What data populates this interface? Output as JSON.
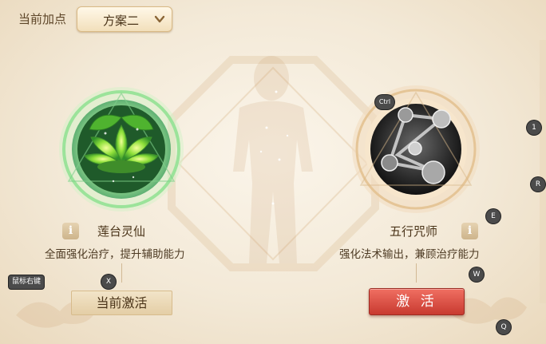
{
  "top": {
    "plan_label": "当前加点",
    "plan_value": "方案二"
  },
  "classes": [
    {
      "name": "莲台灵仙",
      "desc": "全面强化治疗，提升辅助能力",
      "info": "i",
      "icon": "lotus-icon"
    },
    {
      "name": "五行咒师",
      "desc": "强化法术输出，兼顾治疗能力",
      "info": "i",
      "icon": "five-elements-icon"
    }
  ],
  "buttons": {
    "current": "当前激活",
    "activate": "激 活"
  },
  "key_hints": {
    "ctrl": "Ctrl",
    "e": "E",
    "x": "X",
    "w": "W",
    "q": "Q",
    "r": "R",
    "one": "1",
    "mouse_right": "鼠标右键"
  },
  "colors": {
    "background": "#f3e9d7",
    "accent_red": "#d6473b",
    "text_brown": "#4a3419",
    "lotus_green": "#7fd23a"
  }
}
